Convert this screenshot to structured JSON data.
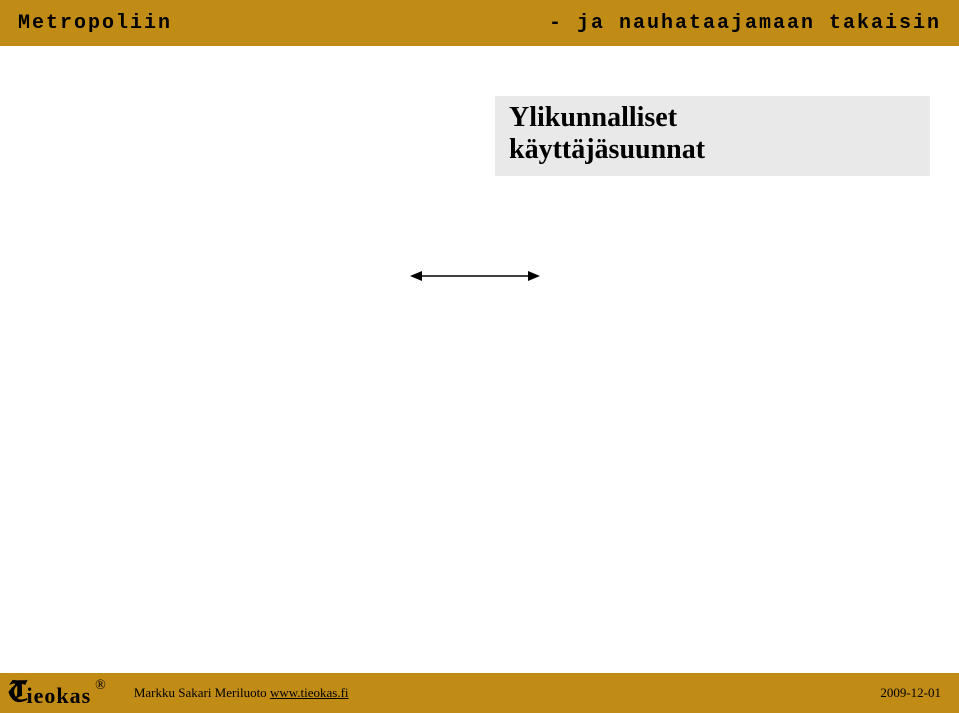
{
  "header": {
    "left": "Metropoliin",
    "right": "- ja nauhataajamaan takaisin"
  },
  "infobox": {
    "line1": "Ylikunnalliset",
    "line2": "käyttäjäsuunnat"
  },
  "footer": {
    "logo_t": "T",
    "logo_rest": "ieokas",
    "logo_r": "®",
    "author": "Markku Sakari Meriluoto ",
    "link": "www.tieokas.fi",
    "date": "2009-12-01"
  }
}
